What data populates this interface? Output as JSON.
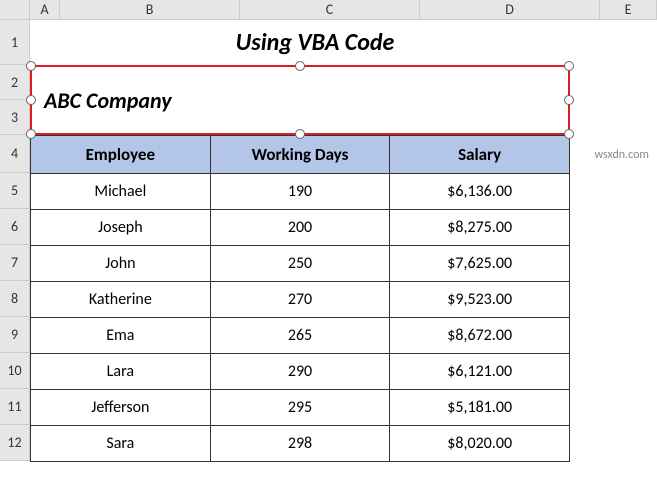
{
  "columns": [
    "A",
    "B",
    "C",
    "D",
    "E"
  ],
  "rows": [
    "1",
    "2",
    "3",
    "4",
    "5",
    "6",
    "7",
    "8",
    "9",
    "10",
    "11",
    "12"
  ],
  "title": "Using VBA Code",
  "textbox": {
    "text": "ABC Company"
  },
  "table": {
    "headers": {
      "employee": "Employee",
      "working_days": "Working Days",
      "salary": "Salary"
    },
    "data": [
      {
        "employee": "Michael",
        "working_days": "190",
        "salary": "$6,136.00"
      },
      {
        "employee": "Joseph",
        "working_days": "200",
        "salary": "$8,275.00"
      },
      {
        "employee": "John",
        "working_days": "250",
        "salary": "$7,625.00"
      },
      {
        "employee": "Katherine",
        "working_days": "270",
        "salary": "$9,523.00"
      },
      {
        "employee": "Ema",
        "working_days": "265",
        "salary": "$8,672.00"
      },
      {
        "employee": "Lara",
        "working_days": "290",
        "salary": "$6,121.00"
      },
      {
        "employee": "Jefferson",
        "working_days": "295",
        "salary": "$5,181.00"
      },
      {
        "employee": "Sara",
        "working_days": "298",
        "salary": "$8,020.00"
      }
    ]
  },
  "watermark": "wsxdn.com",
  "chart_data": {
    "type": "table",
    "title": "Using VBA Code",
    "columns": [
      "Employee",
      "Working Days",
      "Salary"
    ],
    "rows": [
      [
        "Michael",
        190,
        6136.0
      ],
      [
        "Joseph",
        200,
        8275.0
      ],
      [
        "John",
        250,
        7625.0
      ],
      [
        "Katherine",
        270,
        9523.0
      ],
      [
        "Ema",
        265,
        8672.0
      ],
      [
        "Lara",
        290,
        6121.0
      ],
      [
        "Jefferson",
        295,
        5181.0
      ],
      [
        "Sara",
        298,
        8020.0
      ]
    ]
  }
}
